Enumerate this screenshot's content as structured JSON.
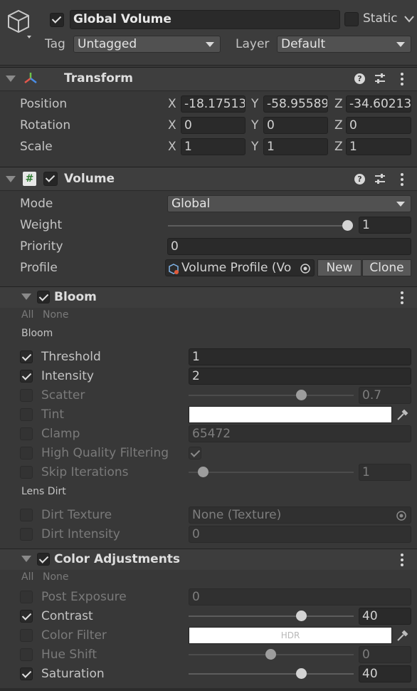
{
  "header": {
    "object_name": "Global Volume",
    "static_label": "Static",
    "tag_label": "Tag",
    "tag_value": "Untagged",
    "layer_label": "Layer",
    "layer_value": "Default"
  },
  "transform": {
    "title": "Transform",
    "position_label": "Position",
    "rotation_label": "Rotation",
    "scale_label": "Scale",
    "axis_x": "X",
    "axis_y": "Y",
    "axis_z": "Z",
    "position": {
      "x": "-18.17513",
      "y": "-58.95589",
      "z": "-34.60213"
    },
    "rotation": {
      "x": "0",
      "y": "0",
      "z": "0"
    },
    "scale": {
      "x": "1",
      "y": "1",
      "z": "1"
    }
  },
  "volume": {
    "title": "Volume",
    "mode_label": "Mode",
    "mode_value": "Global",
    "weight_label": "Weight",
    "weight_value": "1",
    "weight_fraction": 1,
    "priority_label": "Priority",
    "priority_value": "0",
    "profile_label": "Profile",
    "profile_value": "Volume Profile (Vo",
    "new_label": "New",
    "clone_label": "Clone"
  },
  "bloom": {
    "title": "Bloom",
    "all_label": "All",
    "none_label": "None",
    "group_bloom": "Bloom",
    "threshold_label": "Threshold",
    "threshold_value": "1",
    "intensity_label": "Intensity",
    "intensity_value": "2",
    "scatter_label": "Scatter",
    "scatter_value": "0.7",
    "tint_label": "Tint",
    "clamp_label": "Clamp",
    "clamp_value": "65472",
    "hqf_label": "High Quality Filtering",
    "skip_label": "Skip Iterations",
    "skip_value": "1",
    "group_lens": "Lens Dirt",
    "dirt_texture_label": "Dirt Texture",
    "dirt_texture_value": "None (Texture)",
    "dirt_intensity_label": "Dirt Intensity",
    "dirt_intensity_value": "0"
  },
  "color": {
    "title": "Color Adjustments",
    "all_label": "All",
    "none_label": "None",
    "post_exposure_label": "Post Exposure",
    "post_exposure_value": "0",
    "contrast_label": "Contrast",
    "contrast_value": "40",
    "color_filter_label": "Color Filter",
    "color_filter_hdr": "HDR",
    "hue_shift_label": "Hue Shift",
    "hue_shift_value": "0",
    "saturation_label": "Saturation",
    "saturation_value": "40"
  },
  "icons": {
    "gameobject": "cube-icon",
    "transform": "transform-axes-icon",
    "script": "hash-icon",
    "help": "help-icon",
    "presets": "sliders-icon",
    "menu": "kebab-icon",
    "picker": "eyedropper-icon",
    "target": "object-picker-icon",
    "profile": "profile-asset-icon"
  }
}
